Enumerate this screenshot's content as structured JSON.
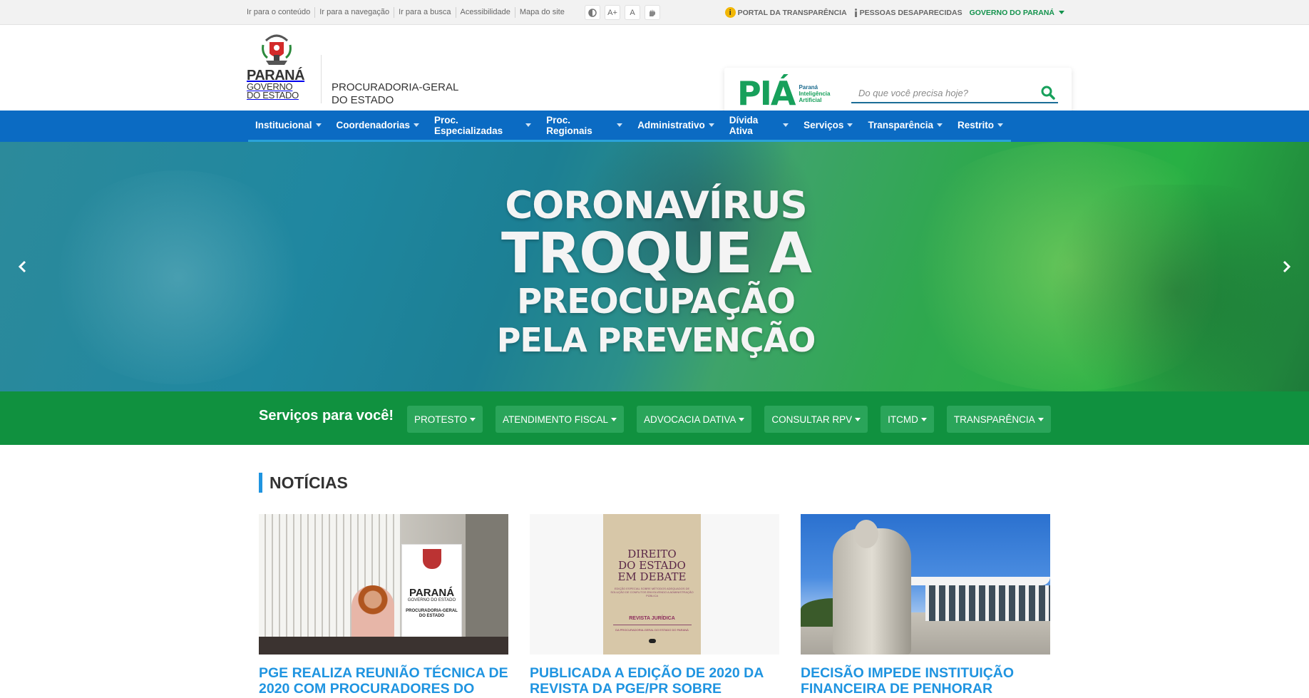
{
  "topbar": {
    "skip_links": [
      "Ir para o conteúdo",
      "Ir para a navegação",
      "Ir para a busca",
      "Acessibilidade",
      "Mapa do site"
    ],
    "accessibility": {
      "font_increase": "A+",
      "font_reset": "A"
    },
    "gov_links": {
      "transparency": "PORTAL DA TRANSPARÊNCIA",
      "missing_persons": "PESSOAS DESAPARECIDAS",
      "government": "GOVERNO DO PARANÁ"
    }
  },
  "header": {
    "logo": {
      "name": "PARANÁ",
      "sub1": "GOVERNO",
      "sub2": "DO ESTADO"
    },
    "org_line1": "PROCURADORIA-GERAL",
    "org_line2": "DO ESTADO",
    "pia": {
      "mark": "PIÁ",
      "line1": "Paraná",
      "line2": "Inteligência",
      "line3": "Artificial"
    },
    "search_placeholder": "Do que você precisa hoje?"
  },
  "nav": {
    "items": [
      "Institucional",
      "Coordenadorias",
      "Proc. Especializadas",
      "Proc. Regionais",
      "Administrativo",
      "Dívida Ativa",
      "Serviços",
      "Transparência",
      "Restrito"
    ]
  },
  "hero": {
    "line1": "CORONAVÍRUS",
    "line2": "TROQUE A",
    "line3": "PREOCUPAÇÃO",
    "line4": "PELA PREVENÇÃO"
  },
  "services": {
    "title": "Serviços para você!",
    "buttons": [
      "PROTESTO",
      "ATENDIMENTO FISCAL",
      "ADVOCACIA DATIVA",
      "CONSULTAR RPV",
      "ITCMD",
      "TRANSPARÊNCIA"
    ]
  },
  "news": {
    "title": "NOTÍCIAS",
    "cards": [
      {
        "headline": "PGE REALIZA REUNIÃO TÉCNICA DE 2020 COM PROCURADORES DO",
        "image": {
          "banner_name": "PARANÁ",
          "banner_sub": "GOVERNO DO ESTADO",
          "banner_org": "PROCURADORIA-GERAL DO ESTADO"
        }
      },
      {
        "headline": "PUBLICADA A EDIÇÃO DE 2020 DA REVISTA DA PGE/PR SOBRE",
        "image": {
          "book_title_1": "DIREITO",
          "book_title_2": "DO ESTADO",
          "book_title_3": "EM DEBATE",
          "book_sub": "EDIÇÃO ESPECIAL SOBRE MÉTODOS ADEQUADOS DE SOLUÇÃO DE CONFLITOS ENVOLVENDO A ADMINISTRAÇÃO PÚBLICA",
          "book_journal": "REVISTA JURÍDICA",
          "book_journal_sub": "DA PROCURADORIA-GERAL DO ESTADO DO PARANÁ"
        }
      },
      {
        "headline": "DECISÃO IMPEDE INSTITUIÇÃO FINANCEIRA DE PENHORAR"
      }
    ]
  },
  "colors": {
    "nav_blue": "#0b6bc3",
    "services_green": "#10913f",
    "link_blue": "#1f94e0",
    "gov_green": "#12924c"
  }
}
